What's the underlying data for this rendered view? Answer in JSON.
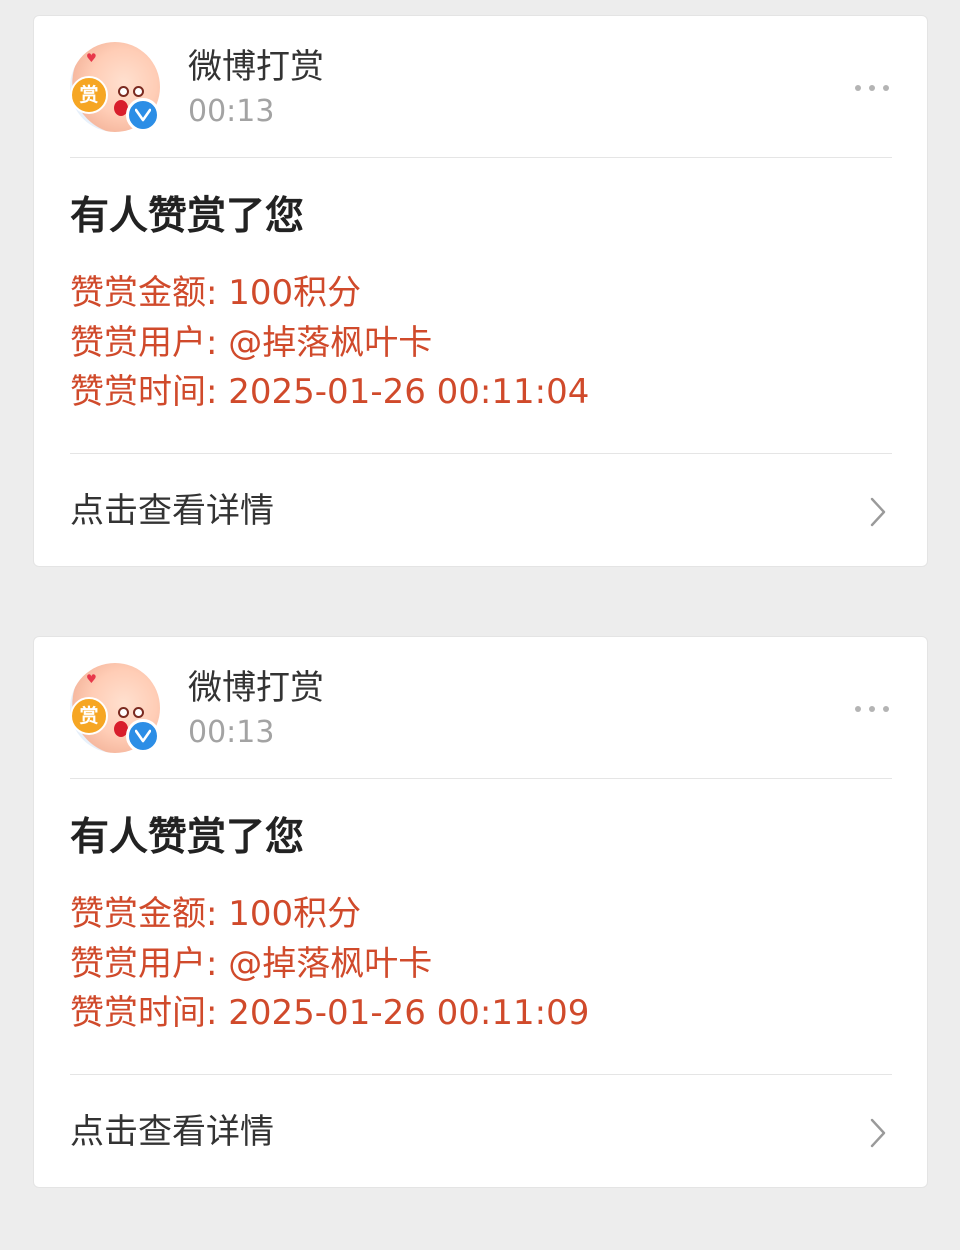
{
  "notifications": [
    {
      "sender_name": "微博打赏",
      "time": "00:13",
      "avatar_badge": "赏",
      "title": "有人赞赏了您",
      "amount_label": "赞赏金额: ",
      "amount_value": "100积分",
      "user_label": "赞赏用户: ",
      "user_value": "@掉落枫叶卡",
      "time_label": "赞赏时间: ",
      "time_value": "2025-01-26 00:11:04",
      "view_detail": "点击查看详情"
    },
    {
      "sender_name": "微博打赏",
      "time": "00:13",
      "avatar_badge": "赏",
      "title": "有人赞赏了您",
      "amount_label": "赞赏金额: ",
      "amount_value": "100积分",
      "user_label": "赞赏用户: ",
      "user_value": "@掉落枫叶卡",
      "time_label": "赞赏时间: ",
      "time_value": "2025-01-26 00:11:09",
      "view_detail": "点击查看详情"
    }
  ],
  "icons": {
    "more": "more-horizontal-icon",
    "chevron": "chevron-right-icon",
    "verified": "verified-check-icon",
    "reward": "reward-badge"
  },
  "colors": {
    "background": "#ededed",
    "card": "#ffffff",
    "detail_text": "#d04a2b",
    "verified_blue": "#2c8ee6",
    "reward_orange": "#f6a623"
  }
}
